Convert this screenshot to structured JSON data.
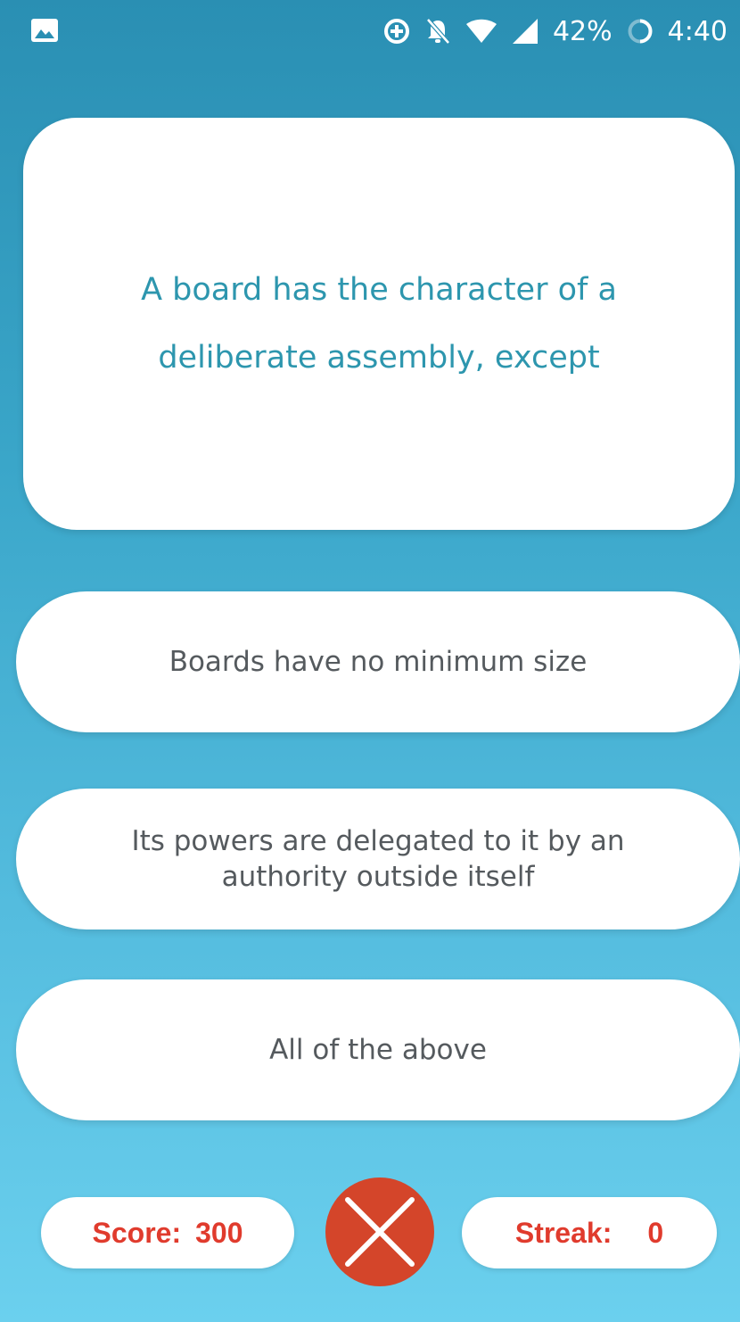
{
  "status_bar": {
    "battery_percent": "42%",
    "time": "4:40",
    "icons": [
      "image-icon",
      "data-saver-icon",
      "notifications-off-icon",
      "wifi-icon",
      "cell-signal-icon",
      "battery-icon"
    ]
  },
  "question": {
    "text": "A board has the character of a deliberate assembly, except"
  },
  "answers": [
    {
      "text": "Boards have no minimum size"
    },
    {
      "text": "Its powers are delegated to it by an authority outside itself"
    },
    {
      "text": "All of the above"
    }
  ],
  "score": {
    "label": "Score:",
    "value": "300"
  },
  "streak": {
    "label": "Streak:",
    "value": "0"
  },
  "colors": {
    "question_text": "#2d96ae",
    "answer_text": "#555a5e",
    "score_text": "#e03b2d",
    "close_button": "#d4452a",
    "background_top": "#2a8fb3",
    "background_bottom": "#6bd0ee"
  }
}
